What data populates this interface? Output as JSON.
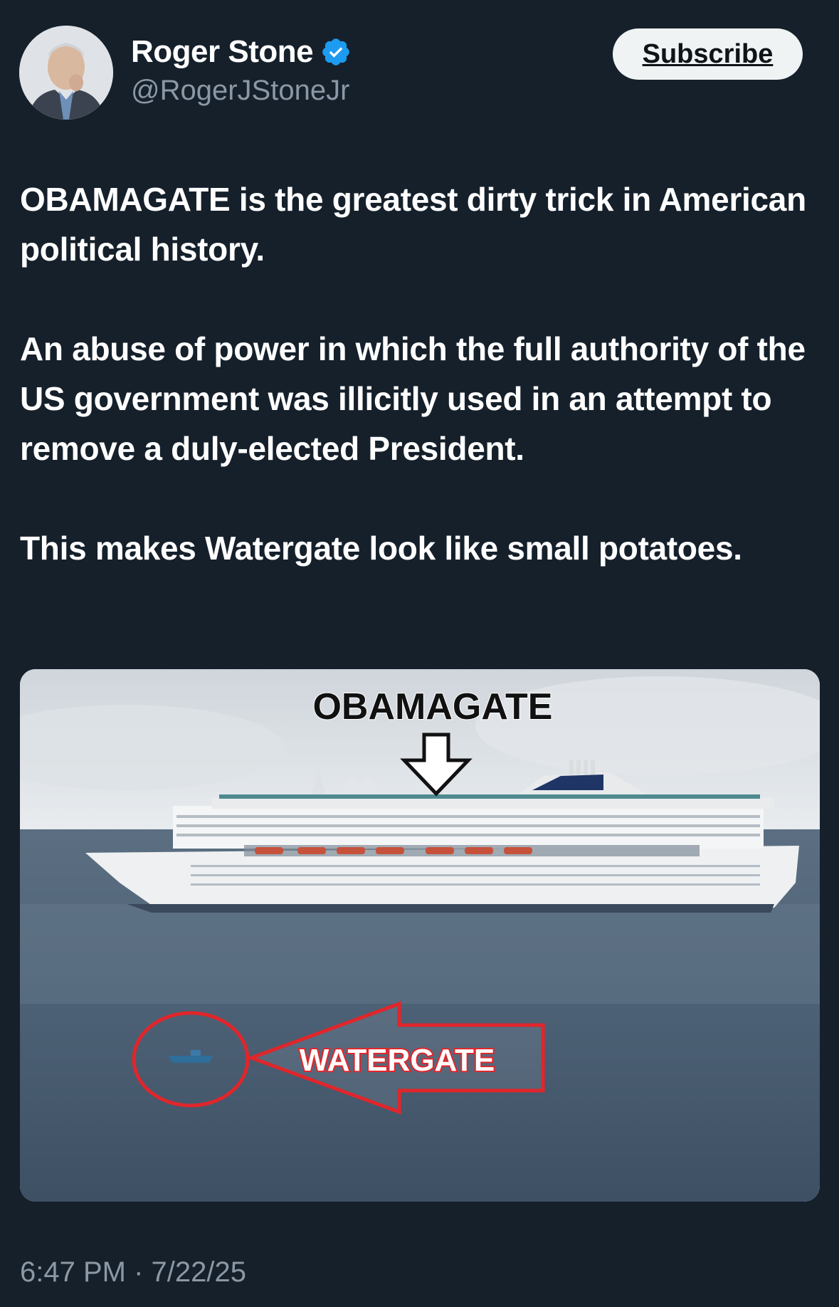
{
  "author": {
    "display_name": "Roger Stone",
    "handle": "@RogerJStoneJr",
    "verified": true,
    "verified_icon": "verified-badge-icon",
    "verified_color": "#1d9bf0"
  },
  "subscribe_label": "Subscribe",
  "tweet": {
    "paragraphs": [
      "OBAMAGATE is the greatest dirty trick in American political history.",
      "An abuse of power in which the full authority of the US government was illicitly used in an attempt to remove a duly-elected President.",
      "This makes Watergate look like small potatoes."
    ]
  },
  "media": {
    "top_label": "OBAMAGATE",
    "bottom_label": "WATERGATE",
    "annotation_color": "#e0262b"
  },
  "timestamp": "6:47 PM · 7/22/25"
}
